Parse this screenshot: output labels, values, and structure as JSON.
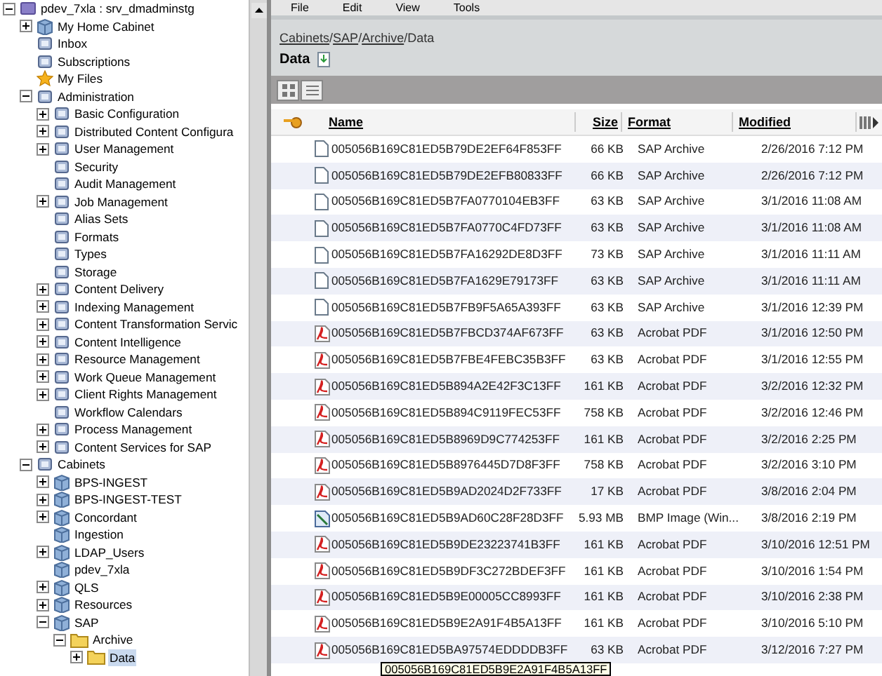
{
  "tree": {
    "label": "pdev_7xla : srv_dmadminstg",
    "kind": "repository",
    "expanded": true,
    "selected": false,
    "children": [
      {
        "label": "My Home Cabinet",
        "kind": "cabinet",
        "expanded": false,
        "selected": false
      },
      {
        "label": "Inbox",
        "kind": "node",
        "selected": false
      },
      {
        "label": "Subscriptions",
        "kind": "node",
        "selected": false
      },
      {
        "label": "My Files",
        "kind": "star",
        "selected": false
      },
      {
        "label": "Administration",
        "kind": "node",
        "expanded": true,
        "selected": false,
        "children": [
          {
            "label": "Basic Configuration",
            "kind": "node",
            "expanded": false,
            "selected": false
          },
          {
            "label": "Distributed Content Configura",
            "kind": "node",
            "expanded": false,
            "selected": false
          },
          {
            "label": "User Management",
            "kind": "node",
            "expanded": false,
            "selected": false
          },
          {
            "label": "Security",
            "kind": "node",
            "selected": false
          },
          {
            "label": "Audit Management",
            "kind": "node",
            "selected": false
          },
          {
            "label": "Job Management",
            "kind": "node",
            "expanded": false,
            "selected": false
          },
          {
            "label": "Alias Sets",
            "kind": "node",
            "selected": false
          },
          {
            "label": "Formats",
            "kind": "node",
            "selected": false
          },
          {
            "label": "Types",
            "kind": "node",
            "selected": false
          },
          {
            "label": "Storage",
            "kind": "node",
            "selected": false
          },
          {
            "label": "Content Delivery",
            "kind": "node",
            "expanded": false,
            "selected": false
          },
          {
            "label": "Indexing Management",
            "kind": "node",
            "expanded": false,
            "selected": false
          },
          {
            "label": "Content Transformation Servic",
            "kind": "node",
            "expanded": false,
            "selected": false
          },
          {
            "label": "Content Intelligence",
            "kind": "node",
            "expanded": false,
            "selected": false
          },
          {
            "label": "Resource Management",
            "kind": "node",
            "expanded": false,
            "selected": false
          },
          {
            "label": "Work Queue Management",
            "kind": "node",
            "expanded": false,
            "selected": false
          },
          {
            "label": "Client Rights Management",
            "kind": "node",
            "expanded": false,
            "selected": false
          },
          {
            "label": "Workflow Calendars",
            "kind": "node",
            "selected": false
          },
          {
            "label": "Process Management",
            "kind": "node",
            "expanded": false,
            "selected": false
          },
          {
            "label": "Content Services for SAP",
            "kind": "node",
            "expanded": false,
            "selected": false
          }
        ]
      },
      {
        "label": "Cabinets",
        "kind": "node",
        "expanded": true,
        "selected": false,
        "children": [
          {
            "label": "BPS-INGEST",
            "kind": "cabinet",
            "expanded": false,
            "selected": false
          },
          {
            "label": "BPS-INGEST-TEST",
            "kind": "cabinet",
            "expanded": false,
            "selected": false
          },
          {
            "label": "Concordant",
            "kind": "cabinet",
            "expanded": false,
            "selected": false
          },
          {
            "label": "Ingestion",
            "kind": "cabinet",
            "selected": false
          },
          {
            "label": "LDAP_Users",
            "kind": "cabinet",
            "expanded": false,
            "selected": false
          },
          {
            "label": "pdev_7xla",
            "kind": "cabinet",
            "selected": false
          },
          {
            "label": "QLS",
            "kind": "cabinet",
            "expanded": false,
            "selected": false
          },
          {
            "label": "Resources",
            "kind": "cabinet",
            "expanded": false,
            "selected": false
          },
          {
            "label": "SAP",
            "kind": "cabinet",
            "expanded": true,
            "selected": false,
            "children": [
              {
                "label": "Archive",
                "kind": "folder",
                "expanded": true,
                "selected": false,
                "children": [
                  {
                    "label": "Data",
                    "kind": "folder",
                    "expanded": false,
                    "selected": true
                  }
                ]
              }
            ]
          }
        ]
      }
    ]
  },
  "menu": [
    "File",
    "Edit",
    "View",
    "Tools"
  ],
  "breadcrumb": {
    "separator": "/",
    "items": [
      {
        "label": "Cabinets",
        "link": true
      },
      {
        "label": "SAP",
        "link": true
      },
      {
        "label": "Archive",
        "link": true
      },
      {
        "label": "Data",
        "link": false
      }
    ]
  },
  "folder_title": "Data",
  "table": {
    "columns": [
      "Name",
      "Size",
      "Format",
      "Modified"
    ],
    "rows": [
      {
        "kind": "file",
        "name": "005056B169C81ED5B79DE2EF64F853FF",
        "size": "66 KB",
        "format": "SAP Archive",
        "modified": "2/26/2016 7:12 PM"
      },
      {
        "kind": "file",
        "name": "005056B169C81ED5B79DE2EFB80833FF",
        "size": "66 KB",
        "format": "SAP Archive",
        "modified": "2/26/2016 7:12 PM"
      },
      {
        "kind": "file",
        "name": "005056B169C81ED5B7FA0770104EB3FF",
        "size": "63 KB",
        "format": "SAP Archive",
        "modified": "3/1/2016 11:08 AM"
      },
      {
        "kind": "file",
        "name": "005056B169C81ED5B7FA0770C4FD73FF",
        "size": "63 KB",
        "format": "SAP Archive",
        "modified": "3/1/2016 11:08 AM"
      },
      {
        "kind": "file",
        "name": "005056B169C81ED5B7FA16292DE8D3FF",
        "size": "73 KB",
        "format": "SAP Archive",
        "modified": "3/1/2016 11:11 AM"
      },
      {
        "kind": "file",
        "name": "005056B169C81ED5B7FA1629E79173FF",
        "size": "63 KB",
        "format": "SAP Archive",
        "modified": "3/1/2016 11:11 AM"
      },
      {
        "kind": "file",
        "name": "005056B169C81ED5B7FB9F5A65A393FF",
        "size": "63 KB",
        "format": "SAP Archive",
        "modified": "3/1/2016 12:39 PM"
      },
      {
        "kind": "pdf",
        "name": "005056B169C81ED5B7FBCD374AF673FF",
        "size": "63 KB",
        "format": "Acrobat PDF",
        "modified": "3/1/2016 12:50 PM"
      },
      {
        "kind": "pdf",
        "name": "005056B169C81ED5B7FBE4FEBC35B3FF",
        "size": "63 KB",
        "format": "Acrobat PDF",
        "modified": "3/1/2016 12:55 PM"
      },
      {
        "kind": "pdf",
        "name": "005056B169C81ED5B894A2E42F3C13FF",
        "size": "161 KB",
        "format": "Acrobat PDF",
        "modified": "3/2/2016 12:32 PM"
      },
      {
        "kind": "pdf",
        "name": "005056B169C81ED5B894C9119FEC53FF",
        "size": "758 KB",
        "format": "Acrobat PDF",
        "modified": "3/2/2016 12:46 PM"
      },
      {
        "kind": "pdf",
        "name": "005056B169C81ED5B8969D9C774253FF",
        "size": "161 KB",
        "format": "Acrobat PDF",
        "modified": "3/2/2016 2:25 PM"
      },
      {
        "kind": "pdf",
        "name": "005056B169C81ED5B8976445D7D8F3FF",
        "size": "758 KB",
        "format": "Acrobat PDF",
        "modified": "3/2/2016 3:10 PM"
      },
      {
        "kind": "pdf",
        "name": "005056B169C81ED5B9AD2024D2F733FF",
        "size": "17 KB",
        "format": "Acrobat PDF",
        "modified": "3/8/2016 2:04 PM"
      },
      {
        "kind": "image",
        "name": "005056B169C81ED5B9AD60C28F28D3FF",
        "size": "5.93 MB",
        "format": "BMP Image (Win...",
        "modified": "3/8/2016 2:19 PM"
      },
      {
        "kind": "pdf",
        "name": "005056B169C81ED5B9DE23223741B3FF",
        "size": "161 KB",
        "format": "Acrobat PDF",
        "modified": "3/10/2016 12:51 PM"
      },
      {
        "kind": "pdf",
        "name": "005056B169C81ED5B9DF3C272BDEF3FF",
        "size": "161 KB",
        "format": "Acrobat PDF",
        "modified": "3/10/2016 1:54 PM"
      },
      {
        "kind": "pdf",
        "name": "005056B169C81ED5B9E00005CC8993FF",
        "size": "161 KB",
        "format": "Acrobat PDF",
        "modified": "3/10/2016 2:38 PM"
      },
      {
        "kind": "pdf",
        "name": "005056B169C81ED5B9E2A91F4B5A13FF",
        "size": "161 KB",
        "format": "Acrobat PDF",
        "modified": "3/10/2016 5:10 PM"
      },
      {
        "kind": "pdf",
        "name": "005056B169C81ED5BA97574EDDDDB3FF",
        "size": "63 KB",
        "format": "Acrobat PDF",
        "modified": "3/12/2016 7:27 PM"
      }
    ]
  },
  "tooltip": "005056B169C81ED5B9E2A91F4B5A13FF"
}
